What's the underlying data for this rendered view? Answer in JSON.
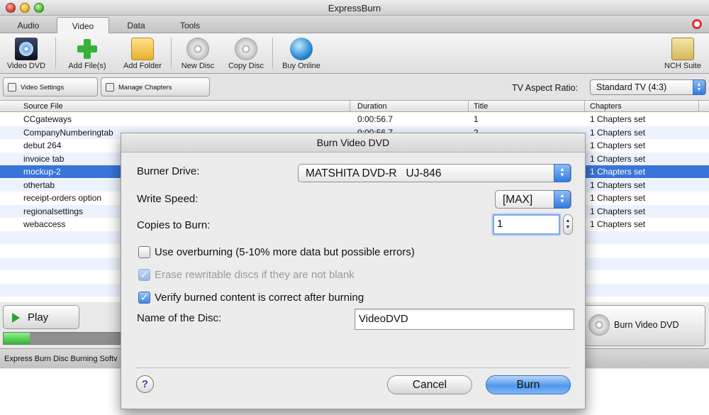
{
  "window": {
    "title": "ExpressBurn"
  },
  "tabs": [
    "Audio",
    "Video",
    "Data",
    "Tools"
  ],
  "toolbar": {
    "video_dvd": "Video DVD",
    "add_files": "Add File(s)",
    "add_folder": "Add Folder",
    "new_disc": "New Disc",
    "copy_disc": "Copy Disc",
    "buy_online": "Buy Online",
    "nch_suite": "NCH Suite"
  },
  "options": {
    "video_settings": "Video Settings",
    "manage_chapters": "Manage Chapters",
    "aspect_label": "TV Aspect Ratio:",
    "aspect_value": "Standard TV (4:3)"
  },
  "table": {
    "headers": [
      "Source File",
      "Duration",
      "Title",
      "Chapters"
    ],
    "rows": [
      {
        "file": "CCgateways",
        "duration": "0:00:56.7",
        "title": "1",
        "chapters": "1 Chapters set"
      },
      {
        "file": "CompanyNumberingtab",
        "duration": "0:00:56.7",
        "title": "2",
        "chapters": "1 Chapters set"
      },
      {
        "file": "debut 264",
        "duration": "",
        "title": "",
        "chapters": "1 Chapters set"
      },
      {
        "file": "invoice tab",
        "duration": "",
        "title": "",
        "chapters": "1 Chapters set"
      },
      {
        "file": "mockup-2",
        "duration": "",
        "title": "",
        "chapters": "1 Chapters set"
      },
      {
        "file": "othertab",
        "duration": "",
        "title": "",
        "chapters": "1 Chapters set"
      },
      {
        "file": "receipt-orders option",
        "duration": "",
        "title": "",
        "chapters": "1 Chapters set"
      },
      {
        "file": "regionalsettings",
        "duration": "",
        "title": "",
        "chapters": "1 Chapters set"
      },
      {
        "file": "webaccess",
        "duration": "",
        "title": "",
        "chapters": "1 Chapters set"
      }
    ],
    "selected_row": 4
  },
  "player": {
    "play_label": "Play",
    "progress": 0.22
  },
  "status": {
    "text": "Express Burn Disc Burning Softv"
  },
  "burn_video_button": "Burn Video DVD",
  "dialog": {
    "title": "Burn Video DVD",
    "burner_drive_label": "Burner Drive:",
    "burner_drive_value": "MATSHITA DVD-R   UJ-846",
    "write_speed_label": "Write Speed:",
    "write_speed_value": "[MAX]",
    "copies_label": "Copies to Burn:",
    "copies_value": "1",
    "overburn_label": "Use overburning (5-10% more data but possible errors)",
    "erase_label": "Erase rewritable discs if they are not blank",
    "verify_label": "Verify burned content is correct after burning",
    "disc_name_label": "Name of the Disc:",
    "disc_name_value": "VideoDVD",
    "help": "?",
    "cancel": "Cancel",
    "burn": "Burn"
  },
  "colors": {
    "selection": "#3875d7",
    "accent_button": "#4f97ec"
  }
}
